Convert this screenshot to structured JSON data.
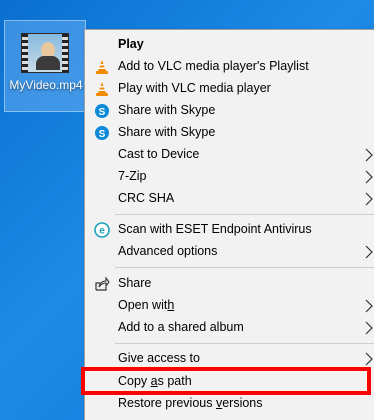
{
  "desktop": {
    "icon_label": "MyVideo.mp4"
  },
  "context_menu": {
    "items": [
      {
        "label": "Play",
        "icon": "none",
        "bold": true
      },
      {
        "label": "Add to VLC media player's Playlist",
        "icon": "vlc-cone-icon"
      },
      {
        "label": "Play with VLC media player",
        "icon": "vlc-cone-icon"
      },
      {
        "label": "Share with Skype",
        "icon": "skype-icon"
      },
      {
        "label": "Share with Skype",
        "icon": "skype-icon"
      },
      {
        "label": "Cast to Device",
        "icon": "none",
        "submenu": true
      },
      {
        "label": "7-Zip",
        "icon": "none",
        "submenu": true
      },
      {
        "label": "CRC SHA",
        "icon": "none",
        "submenu": true
      },
      {
        "label": "Scan with ESET Endpoint Antivirus",
        "icon": "eset-icon"
      },
      {
        "label": "Advanced options",
        "icon": "none",
        "submenu": true
      },
      {
        "label": "Share",
        "icon": "share-icon"
      },
      {
        "label_pre": "Open wit",
        "label_u": "h",
        "label_post": "",
        "icon": "none",
        "submenu": true
      },
      {
        "label": "Add to a shared album",
        "icon": "none",
        "submenu": true
      },
      {
        "label": "Give access to",
        "icon": "none",
        "submenu": true
      },
      {
        "label_pre": "Copy ",
        "label_u": "a",
        "label_post": "s path",
        "icon": "none",
        "highlighted": true
      },
      {
        "label_pre": "Restore previous ",
        "label_u": "v",
        "label_post": "ersions",
        "icon": "none"
      }
    ]
  },
  "colors": {
    "desktop_blue": "#0f77d8",
    "menu_bg": "#f2f2f2",
    "highlight_red": "#ff0000",
    "vlc_orange": "#f08a00",
    "skype_blue": "#0a8ad8",
    "eset_teal": "#1aa3b8"
  }
}
